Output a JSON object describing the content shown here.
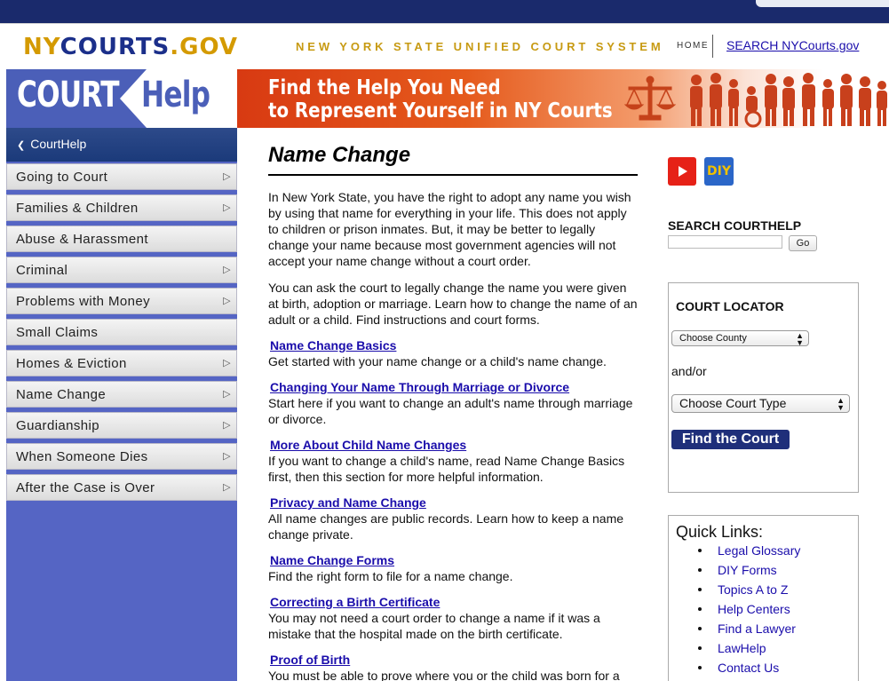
{
  "header": {
    "logo": {
      "ny": "NY",
      "courts": "COURTS",
      "gov": ".GOV"
    },
    "tagline": "NEW YORK STATE UNIFIED COURT SYSTEM",
    "home_link": "HOME",
    "search_link": "SEARCH NYCourts.gov"
  },
  "banner": {
    "logo_court": "COURT",
    "logo_help": "Help",
    "headline_line1": "Find the Help You Need",
    "headline_line2": "to Represent Yourself in NY Courts",
    "accent_color": "#d83a12"
  },
  "sidebar": {
    "home_label": "CourtHelp",
    "items": [
      {
        "label": "Going to Court",
        "has_submenu": true
      },
      {
        "label": "Families & Children",
        "has_submenu": true
      },
      {
        "label": "Abuse & Harassment",
        "has_submenu": false
      },
      {
        "label": "Criminal",
        "has_submenu": true
      },
      {
        "label": "Problems with Money",
        "has_submenu": true
      },
      {
        "label": "Small Claims",
        "has_submenu": false
      },
      {
        "label": "Homes & Eviction",
        "has_submenu": true
      },
      {
        "label": "Name Change",
        "has_submenu": true
      },
      {
        "label": "Guardianship",
        "has_submenu": true
      },
      {
        "label": "When Someone Dies",
        "has_submenu": true
      },
      {
        "label": "After the Case is Over",
        "has_submenu": true
      }
    ]
  },
  "main": {
    "title": "Name Change",
    "intro": [
      "In New York State, you have the right to adopt any name you wish by using that name for everything in your life. This does not apply to children or prison inmates. But, it may be better to legally change your name because most government agencies will not accept your name change without a court order.",
      "You can ask the court to legally change the name you were given at birth, adoption or marriage. Learn how to change the name of an adult or a child. Find instructions and court forms."
    ],
    "topics": [
      {
        "link": "Name Change Basics",
        "desc": "Get started with your name change or a child's name change."
      },
      {
        "link": "Changing Your Name Through Marriage or Divorce",
        "desc": "Start here if you want to change an adult's name through marriage or divorce."
      },
      {
        "link": "More About Child Name Changes",
        "desc": "If you want to change a child's name, read Name Change Basics first, then this section for more helpful information."
      },
      {
        "link": "Privacy and Name Change",
        "desc": "All name changes are public records. Learn how to keep a name change private."
      },
      {
        "link": "Name Change Forms",
        "desc": "Find the right form to file for a name change."
      },
      {
        "link": "Correcting a Birth Certificate",
        "desc": "You may not need a court order to change a name if it was a mistake that the hospital made on the birth certificate."
      },
      {
        "link": "Proof of Birth",
        "desc": "You must be able to prove where you or the child was born for a name change."
      }
    ]
  },
  "right": {
    "media": {
      "youtube_icon": "youtube-icon",
      "diy_label": "DIY"
    },
    "search": {
      "label": "SEARCH COURTHELP",
      "value": "",
      "button": "Go"
    },
    "locator": {
      "title": "COURT LOCATOR",
      "county_select": "Choose County",
      "and_or": "and/or",
      "court_type_select": "Choose Court Type",
      "find_button": "Find the Court"
    },
    "quick_links": {
      "title": "Quick Links:",
      "links": [
        "Legal Glossary",
        "DIY Forms",
        "Topics A to Z",
        "Help Centers",
        "Find a Lawyer",
        "LawHelp",
        "Contact Us"
      ]
    }
  }
}
